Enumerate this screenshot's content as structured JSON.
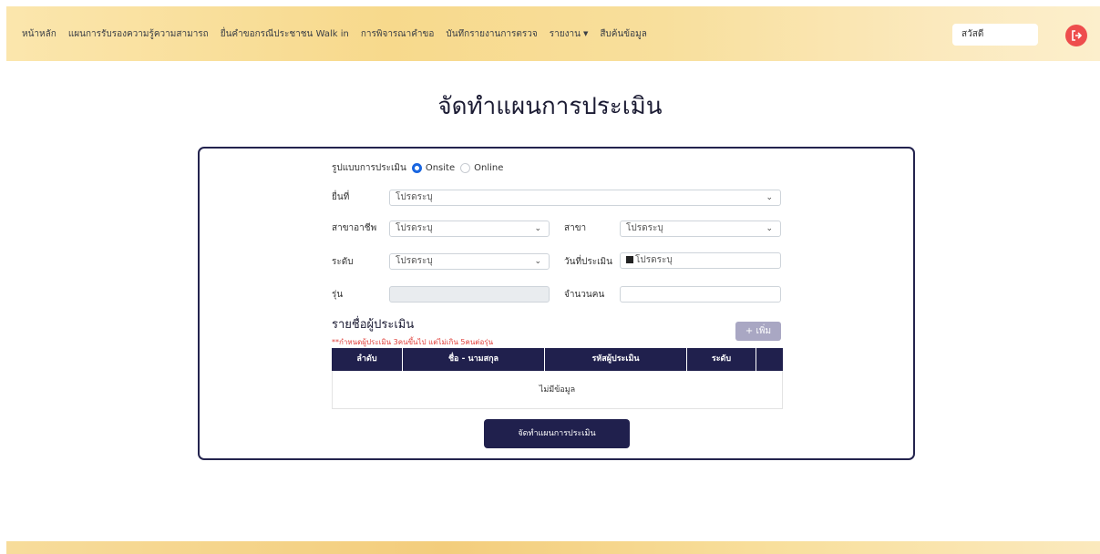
{
  "nav": {
    "items": [
      {
        "label": "หน้าหลัก"
      },
      {
        "label": "แผนการรับรองความรู้ความสามารถ"
      },
      {
        "label": "ยื่นคำขอกรณีประชาชน Walk in"
      },
      {
        "label": "การพิจารณาคำขอ"
      },
      {
        "label": "บันทึกรายงานการตรวจ"
      },
      {
        "label": "รายงาน",
        "has_dropdown": true
      },
      {
        "label": "สืบค้นข้อมูล"
      }
    ],
    "greeting": "สวัสดี",
    "logout_icon": "logout-icon",
    "logout_color": "#ee4d4d"
  },
  "page_title": "จัดทำแผนการประเมิน",
  "form": {
    "mode_label": "รูปแบบการประเมิน",
    "mode_options": [
      {
        "label": "Onsite",
        "selected": true
      },
      {
        "label": "Online",
        "selected": false
      }
    ],
    "site_label": "ยื่นที่",
    "site_value": "โปรดระบุ",
    "career_label": "สาขาอาชีพ",
    "career_value": "โปรดระบุ",
    "branch_label": "สาขา",
    "branch_value": "โปรดระบุ",
    "level_label": "ระดับ",
    "level_value": "โปรดระบุ",
    "date_label": "วันที่ประเมิน",
    "date_placeholder": "โปรดระบุ",
    "batch_label": "รุ่น",
    "batch_value": "",
    "count_label": "จำนวนคน",
    "count_value": ""
  },
  "assessors": {
    "title": "รายชื่อผู้ประเมิน",
    "note": "**กำหนดผู้ประเมิน 3คนขึ้นไป แต่ไม่เกิน 5คนต่อรุ่น",
    "add_label": "+ เพิ่ม",
    "columns": [
      "ลำดับ",
      "ชื่อ - นามสกุล",
      "รหัสผู้ประเมิน",
      "ระดับ",
      ""
    ],
    "empty_text": "ไม่มีข้อมูล"
  },
  "submit_label": "จัดทำแผนการประเมิน",
  "colors": {
    "primary": "#20204d",
    "radio_selected": "#1a66e0",
    "note": "#e0413c"
  }
}
